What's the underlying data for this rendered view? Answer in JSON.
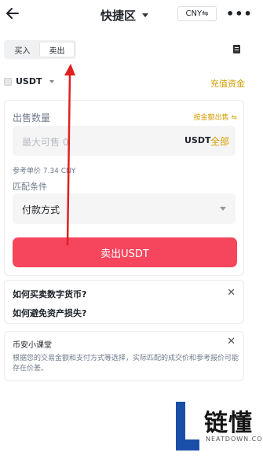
{
  "header": {
    "back_icon": "arrow-left-icon",
    "title": "快捷区",
    "currency": "CNY⇋",
    "more_icon": "more-dots-icon"
  },
  "tabs": [
    {
      "label": "买入",
      "active": false
    },
    {
      "label": "卖出",
      "active": true
    }
  ],
  "order_icon": "receipt-icon",
  "coin": {
    "name": "USDT"
  },
  "recharge_label": "充值资金",
  "sell_form": {
    "quantity_label": "出售数量",
    "by_amount_label": "按金额出售 ⇋",
    "quantity_placeholder": "最大可售 0",
    "unit": "USDT",
    "all_label": "全部",
    "ref_price": "参考单价 7.34 CNY",
    "match_label": "匹配条件",
    "payment_method": "付款方式",
    "submit_label": "卖出USDT",
    "accent_color": "#f6465d",
    "highlight_color": "#d49c00"
  },
  "faq": {
    "q1": "如何买卖数字货币?",
    "q2": "如何避免资产损失?",
    "close_icon": "close-icon"
  },
  "classroom": {
    "title": "币安小课堂",
    "text": "根据您的交易金额和支付方式等选择，实际匹配的成交价和参考报价可能存在价差。",
    "close_icon": "close-icon"
  },
  "watermark": {
    "logo_icon": "letter-l-logo",
    "text": "链懂",
    "sub": "NEATDOWN.COM"
  }
}
